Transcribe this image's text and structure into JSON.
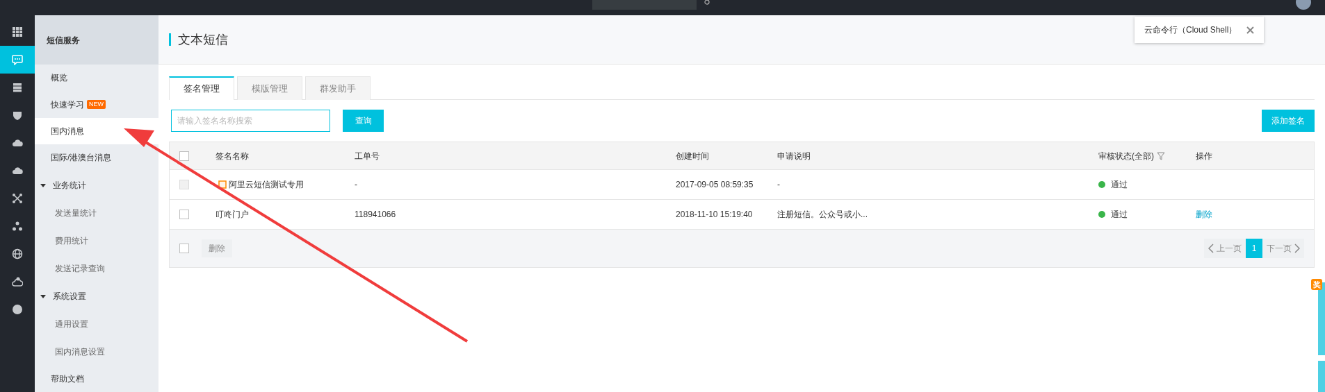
{
  "icon_rail": [
    {
      "kind": "grid",
      "selected": false
    },
    {
      "kind": "chat",
      "selected": true
    },
    {
      "kind": "server",
      "selected": false
    },
    {
      "kind": "shield",
      "selected": false
    },
    {
      "kind": "cloud",
      "selected": false
    },
    {
      "kind": "cloud-up",
      "selected": false
    },
    {
      "kind": "network",
      "selected": false
    },
    {
      "kind": "nodes",
      "selected": false
    },
    {
      "kind": "globe",
      "selected": false
    },
    {
      "kind": "gear-cloud",
      "selected": false
    },
    {
      "kind": "circle",
      "selected": false
    }
  ],
  "sidebar": {
    "title": "短信服务",
    "items": [
      {
        "label": "概览",
        "selected": false
      },
      {
        "label": "快速学习",
        "badge": "NEW",
        "selected": false
      },
      {
        "label": "国内消息",
        "selected": true
      },
      {
        "label": "国际/港澳台消息",
        "selected": false
      },
      {
        "label": "业务统计",
        "expanded": true,
        "children": [
          {
            "label": "发送量统计",
            "selected": false
          },
          {
            "label": "费用统计",
            "selected": false
          },
          {
            "label": "发送记录查询",
            "selected": false
          }
        ]
      },
      {
        "label": "系统设置",
        "expanded": true,
        "children": [
          {
            "label": "通用设置",
            "selected": false
          },
          {
            "label": "国内消息设置",
            "selected": false
          }
        ]
      },
      {
        "label": "帮助文档",
        "selected": false
      }
    ]
  },
  "page_title": "文本短信",
  "cloud_shell_tip": {
    "text": "云命令行（Cloud Shell）"
  },
  "tabs": [
    {
      "label": "签名管理",
      "selected": true
    },
    {
      "label": "模版管理",
      "selected": false
    },
    {
      "label": "群发助手",
      "selected": false
    }
  ],
  "search": {
    "placeholder": "请输入签名名称搜索",
    "button": "查询"
  },
  "add_button": "添加签名",
  "table": {
    "all_checked": false,
    "columns": [
      "签名名称",
      "工单号",
      "创建时间",
      "申请说明",
      "审核状态(全部)",
      "操作"
    ],
    "rows": [
      {
        "checked": false,
        "disabled": true,
        "marked": true,
        "name": "阿里云短信测试专用",
        "ticket": "-",
        "created": "2017-09-05 08:59:35",
        "note": "-",
        "status": "通过"
      },
      {
        "checked": false,
        "disabled": false,
        "marked": false,
        "name": "叮咚门户",
        "ticket": "118941066",
        "created": "2018-11-10 15:19:40",
        "note": "注册短信。公众号或小...",
        "status": "通过",
        "action": "删除"
      }
    ]
  },
  "footer": {
    "checked": false,
    "bulk_delete": {
      "label": "删除",
      "disabled": true
    },
    "prev": {
      "label": "上一页",
      "disabled": true
    },
    "pages": [
      {
        "label": "1",
        "selected": true
      }
    ],
    "next": {
      "label": "下一页",
      "disabled": true
    }
  },
  "side_float": {
    "badge": "奖"
  }
}
